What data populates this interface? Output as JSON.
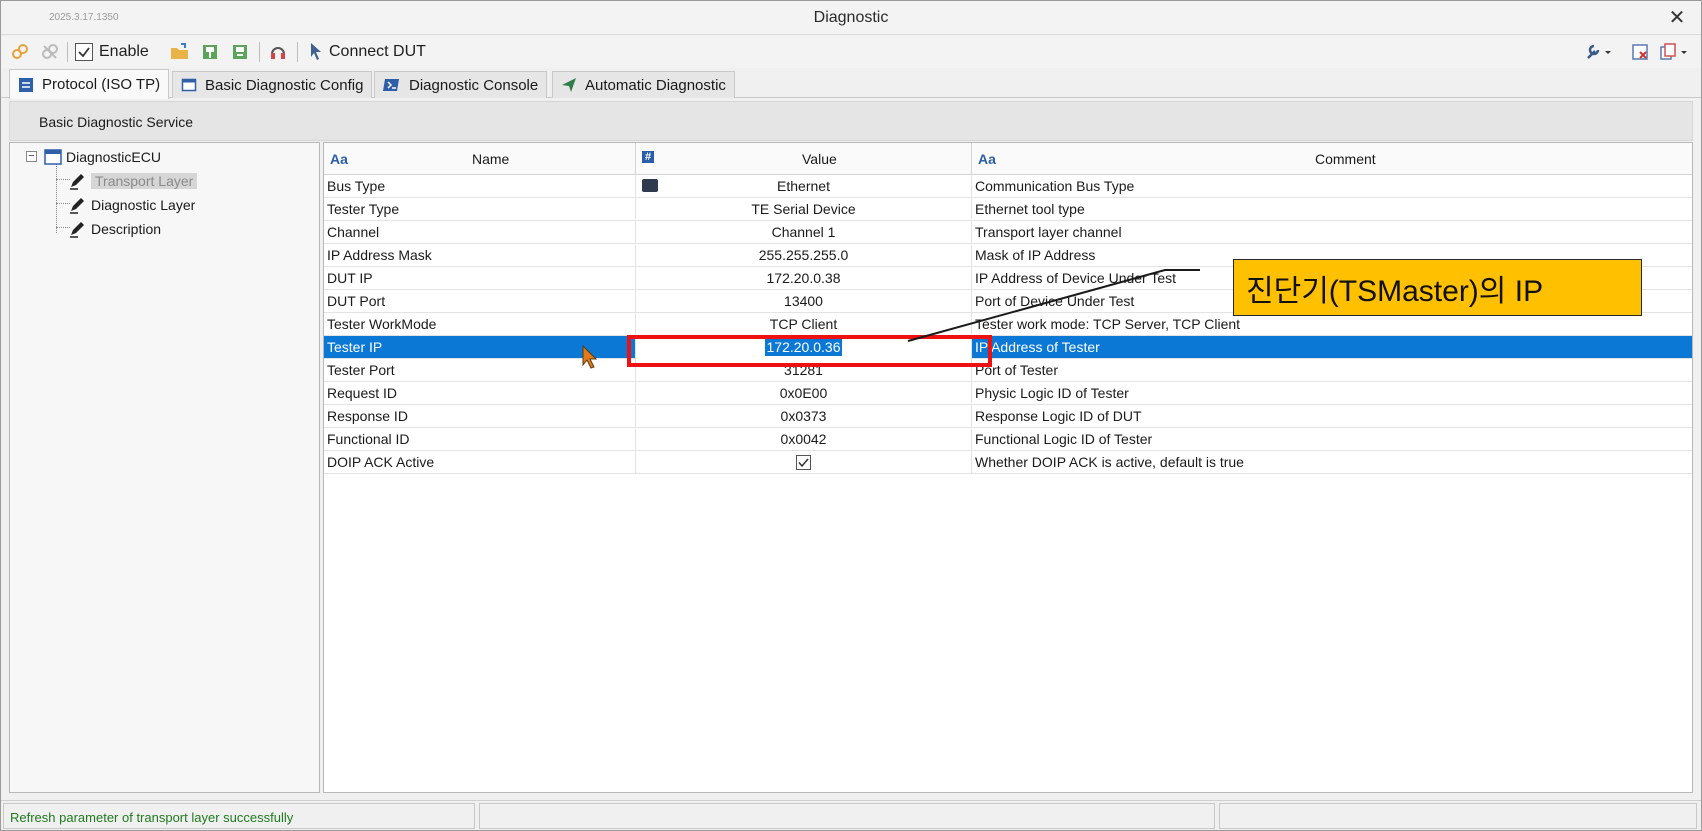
{
  "window": {
    "version": "2025.3.17.1350",
    "title": "Diagnostic"
  },
  "toolbar": {
    "enable_label": "Enable",
    "connect_label": "Connect DUT",
    "enable_checked": true
  },
  "tabs": [
    {
      "label": "Protocol (ISO TP)",
      "active": true
    },
    {
      "label": "Basic Diagnostic Config",
      "active": false
    },
    {
      "label": "Diagnostic Console",
      "active": false
    },
    {
      "label": "Automatic Diagnostic",
      "active": false
    }
  ],
  "subheader": {
    "label": "Basic Diagnostic Service"
  },
  "tree": {
    "root": "DiagnosticECU",
    "children": [
      {
        "label": "Transport Layer",
        "selected": true
      },
      {
        "label": "Diagnostic Layer",
        "selected": false
      },
      {
        "label": "Description",
        "selected": false
      }
    ]
  },
  "grid": {
    "columns": {
      "name": "Name",
      "value": "Value",
      "comment": "Comment"
    },
    "column_icons": {
      "name": "Aa",
      "value": "#",
      "comment": "Aa"
    },
    "rows": [
      {
        "name": "Bus Type",
        "value": "Ethernet",
        "comment": "Communication Bus Type"
      },
      {
        "name": "Tester Type",
        "value": "TE Serial Device",
        "comment": "Ethernet tool type"
      },
      {
        "name": "Channel",
        "value": "Channel 1",
        "comment": "Transport layer channel"
      },
      {
        "name": "IP Address Mask",
        "value": "255.255.255.0",
        "comment": "Mask of IP Address"
      },
      {
        "name": "DUT IP",
        "value": "172.20.0.38",
        "comment": "IP Address of Device Under Test"
      },
      {
        "name": "DUT Port",
        "value": "13400",
        "comment": "Port of Device Under Test"
      },
      {
        "name": "Tester WorkMode",
        "value": "TCP Client",
        "comment": "Tester work mode: TCP Server, TCP Client"
      },
      {
        "name": "Tester IP",
        "value": "172.20.0.36",
        "comment": "IP Address of Tester",
        "selected": true
      },
      {
        "name": "Tester Port",
        "value": "31281",
        "comment": "Port of Tester"
      },
      {
        "name": "Request ID",
        "value": "0x0E00",
        "comment": "Physic Logic ID of Tester"
      },
      {
        "name": "Response ID",
        "value": "0x0373",
        "comment": "Response Logic ID of DUT"
      },
      {
        "name": "Functional ID",
        "value": "0x0042",
        "comment": "Functional Logic ID of Tester"
      },
      {
        "name": "DOIP ACK Active",
        "value": "",
        "comment": "Whether DOIP ACK is active, default is true",
        "checkbox": true
      }
    ]
  },
  "statusbar": {
    "message": "Refresh parameter of transport layer successfully"
  },
  "annotation": {
    "callout_text": "진단기(TSMaster)의  IP"
  },
  "colors": {
    "selection": "#0a78d4",
    "highlight_box": "#ee1111",
    "callout_bg": "#ffc000",
    "status_text": "#1f7a1f"
  }
}
